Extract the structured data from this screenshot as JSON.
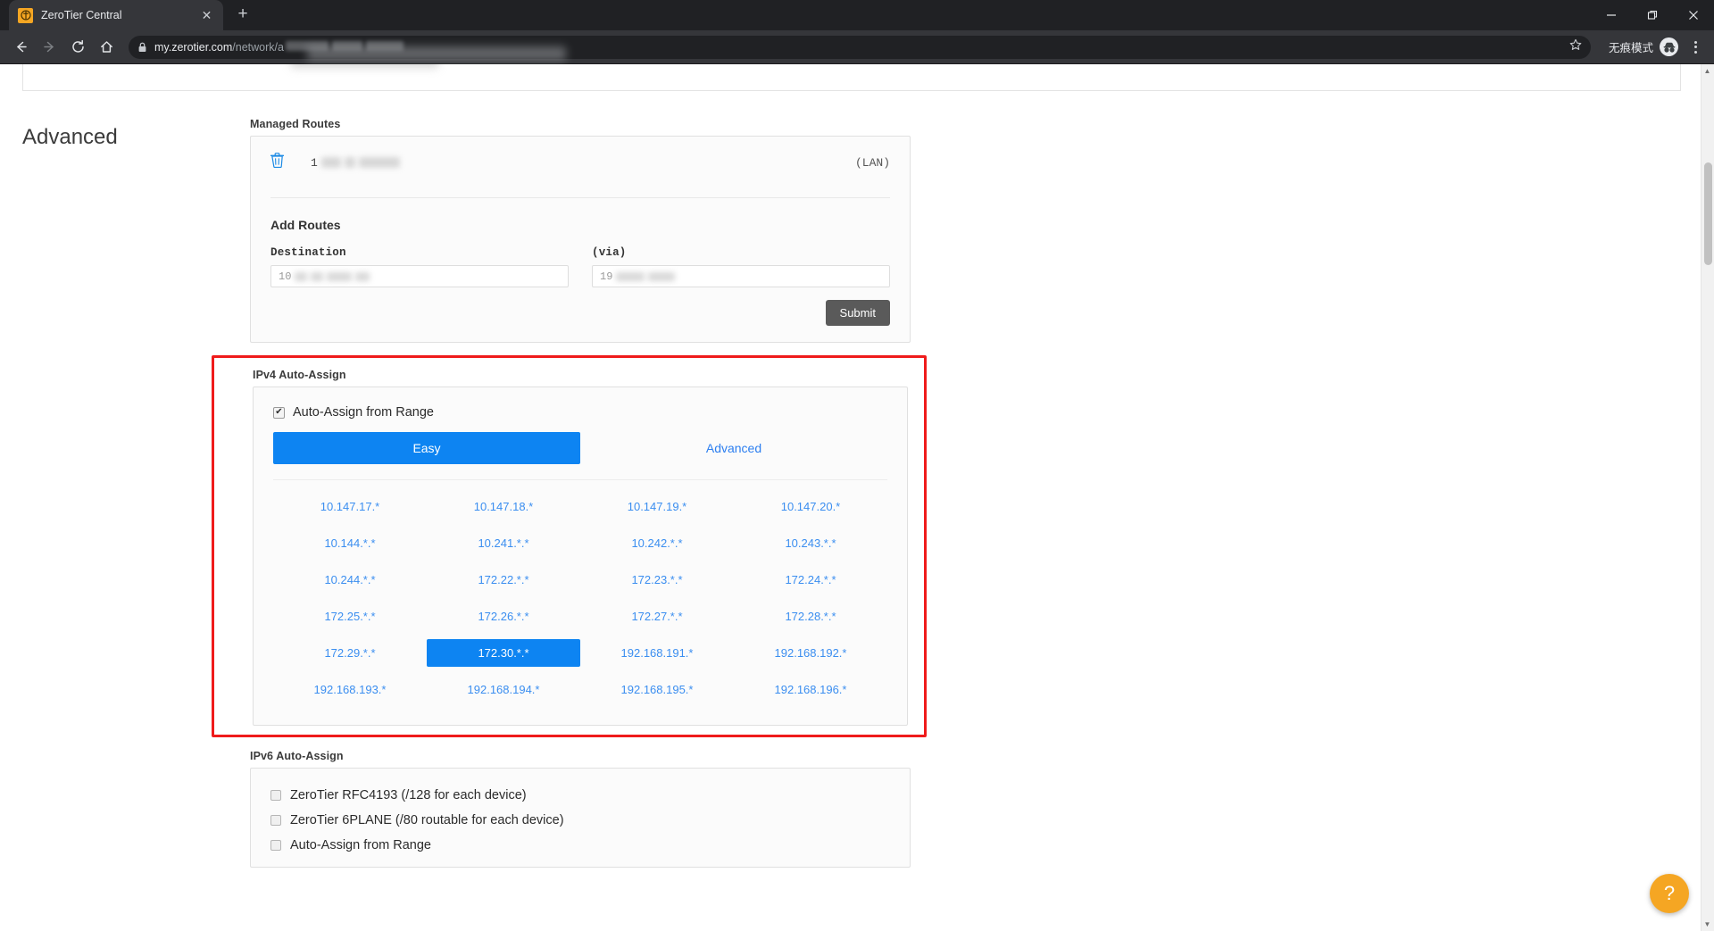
{
  "browser": {
    "tab_title": "ZeroTier Central",
    "tab_close": "✕",
    "new_tab": "+",
    "minimize": "—",
    "maximize": "❐",
    "close": "✕",
    "url_host": "my.zerotier.com",
    "url_path": "/network/a",
    "incognito_label": "无痕模式"
  },
  "page": {
    "section_title": "Advanced",
    "managed_routes": {
      "label": "Managed Routes",
      "rows": [
        {
          "prefix": "1",
          "tag": "(LAN)"
        }
      ],
      "add_routes_title": "Add Routes",
      "destination_label": "Destination",
      "via_label": "(via)",
      "destination_value": "10",
      "via_value": "19",
      "submit_label": "Submit"
    },
    "ipv4": {
      "label": "IPv4 Auto-Assign",
      "auto_assign_checkbox_label": "Auto-Assign from Range",
      "auto_assign_checked": true,
      "tabs": [
        {
          "label": "Easy",
          "active": true
        },
        {
          "label": "Advanced",
          "active": false
        }
      ],
      "selected_range": "172.30.*.*",
      "ranges": [
        "10.147.17.*",
        "10.147.18.*",
        "10.147.19.*",
        "10.147.20.*",
        "10.144.*.*",
        "10.241.*.*",
        "10.242.*.*",
        "10.243.*.*",
        "10.244.*.*",
        "172.22.*.*",
        "172.23.*.*",
        "172.24.*.*",
        "172.25.*.*",
        "172.26.*.*",
        "172.27.*.*",
        "172.28.*.*",
        "172.29.*.*",
        "172.30.*.*",
        "192.168.191.*",
        "192.168.192.*",
        "192.168.193.*",
        "192.168.194.*",
        "192.168.195.*",
        "192.168.196.*"
      ]
    },
    "ipv6": {
      "label": "IPv6 Auto-Assign",
      "options": [
        {
          "label": "ZeroTier RFC4193 (/128 for each device)",
          "checked": false
        },
        {
          "label": "ZeroTier 6PLANE (/80 routable for each device)",
          "checked": false
        },
        {
          "label": "Auto-Assign from Range",
          "checked": false
        }
      ]
    },
    "help_label": "?"
  },
  "colors": {
    "accent_blue": "#0d84f2",
    "link_blue": "#3b8ef0",
    "highlight_red": "#ef1b1b",
    "submit_gray": "#5a5a5a",
    "fab_orange": "#f5a623"
  }
}
